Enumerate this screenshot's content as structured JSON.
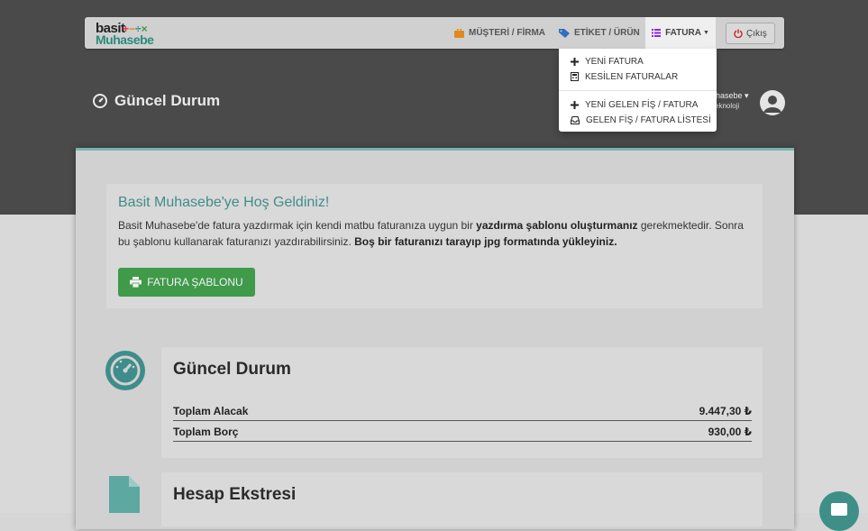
{
  "navbar": {
    "logo_top": "basit",
    "logo_ops": "+−÷×",
    "logo_bottom": "Muhasebe",
    "items": [
      {
        "label": "MÜŞTERİ / FİRMA",
        "icon": "briefcase-icon"
      },
      {
        "label": "ETİKET / ÜRÜN",
        "icon": "tag-icon"
      },
      {
        "label": "FATURA",
        "icon": "list-icon"
      }
    ],
    "logout_label": "Çıkış"
  },
  "fatura_menu": {
    "items": [
      {
        "label": "YENİ FATURA",
        "icon": "plus-icon"
      },
      {
        "label": "KESİLEN FATURALAR",
        "icon": "calculator-icon"
      },
      {
        "label": "YENİ GELEN FİŞ / FATURA",
        "icon": "plus-icon"
      },
      {
        "label": "GELEN FİŞ / FATURA LİSTESİ",
        "icon": "inbox-icon"
      }
    ]
  },
  "header": {
    "title": "Güncel Durum",
    "user_line1": "uhasebe ▾",
    "user_line2": "Teknoloji"
  },
  "welcome": {
    "title": "Basit Muhasebe'ye Hoş Geldiniz!",
    "text1": "Basit Muhasebe'de fatura yazdırmak için kendi matbu faturanıza uygun bir ",
    "text1_bold": "yazdırma şablonu oluşturmanız",
    "text2": " gerekmektedir. Sonra bu şablonu kullanarak faturanızı yazdırabilirsiniz. ",
    "text2_bold": "Boş bir faturanızı tarayıp jpg formatında yükleyiniz.",
    "button_label": "FATURA ŞABLONU"
  },
  "summary": {
    "title": "Güncel Durum",
    "rows": [
      {
        "label": "Toplam Alacak",
        "value": "9.447,30 ₺"
      },
      {
        "label": "Toplam Borç",
        "value": "930,00 ₺"
      }
    ]
  },
  "statement": {
    "title": "Hesap Ekstresi"
  },
  "colors": {
    "accent": "#3f8d8a",
    "button_green": "#3f9a4a",
    "fatura_purple": "#8a2be2",
    "nav_orange": "#e08a1e",
    "nav_blue": "#2f6fbf",
    "logout_red": "#cc2222"
  }
}
